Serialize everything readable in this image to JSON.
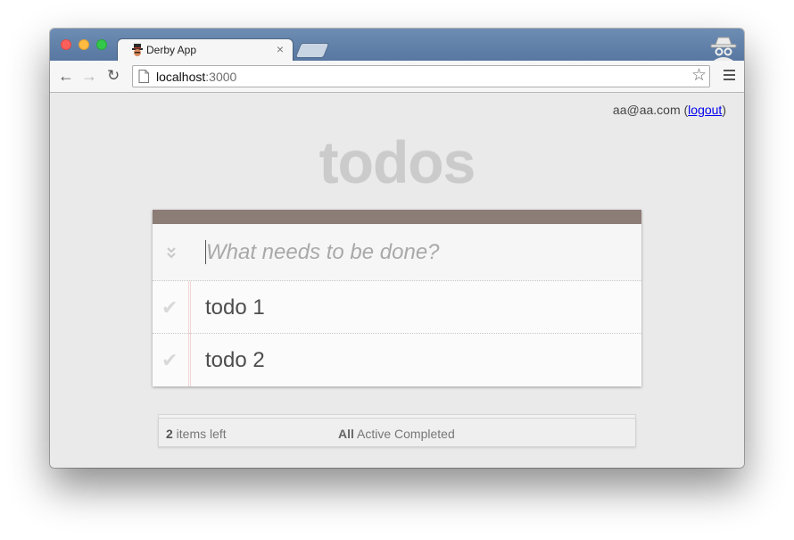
{
  "browser": {
    "tab_title": "Derby App",
    "tab_close": "×",
    "url_host": "localhost",
    "url_port": ":3000",
    "star": "☆",
    "back": "←",
    "forward": "→",
    "reload": "↻",
    "accent": "#5877a1"
  },
  "page": {
    "user_email": "aa@aa.com",
    "logout_open": " (",
    "logout_label": "logout",
    "logout_close": ")",
    "title": "todos",
    "new_todo_placeholder": "What needs to be done?",
    "todos": [
      {
        "label": "todo 1",
        "completed": false
      },
      {
        "label": "todo 2",
        "completed": false
      }
    ],
    "check_glyph": "✔",
    "footer": {
      "count": "2",
      "count_suffix": " items left",
      "filters": [
        "All",
        "Active",
        "Completed"
      ]
    },
    "header_color": "#8d7d77"
  }
}
